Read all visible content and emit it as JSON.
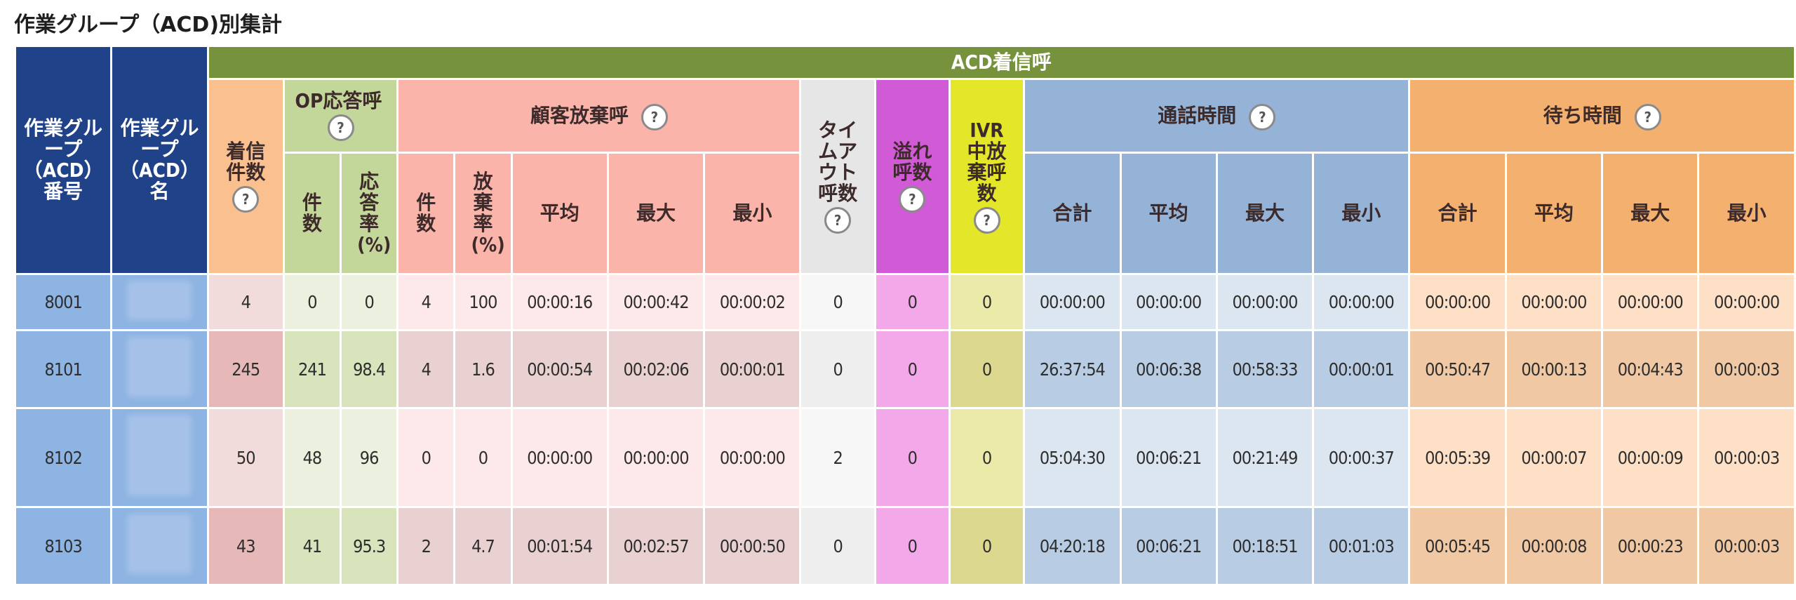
{
  "page_title": "作業グループ（ACD)別集計",
  "banner": "ACD着信呼",
  "help_glyph": "?",
  "headers": {
    "group_no": "作業グループ（ACD）番号",
    "group_name": "作業グループ（ACD）名",
    "incoming": "着信件数",
    "op_answer": "OP応答呼",
    "op_count": "件数",
    "op_rate": "応答率(%)",
    "abandon": "顧客放棄呼",
    "ab_count": "件数",
    "ab_rate": "放棄率(%)",
    "ab_avg": "平均",
    "ab_max": "最大",
    "ab_min": "最小",
    "timeout": "タイムアウト呼数",
    "overflow": "溢れ呼数",
    "ivr": "IVR中放棄呼数",
    "talk": "通話時間",
    "tk_total": "合計",
    "tk_avg": "平均",
    "tk_max": "最大",
    "tk_min": "最小",
    "wait": "待ち時間",
    "wt_total": "合計",
    "wt_avg": "平均",
    "wt_max": "最大",
    "wt_min": "最小"
  },
  "rows": [
    {
      "id": "8001",
      "incoming": "4",
      "op_count": "0",
      "op_rate": "0",
      "ab_count": "4",
      "ab_rate": "100",
      "ab_avg": "00:00:16",
      "ab_max": "00:00:42",
      "ab_min": "00:00:02",
      "timeout": "0",
      "overflow": "0",
      "ivr": "0",
      "tk_total": "00:00:00",
      "tk_avg": "00:00:00",
      "tk_max": "00:00:00",
      "tk_min": "00:00:00",
      "wt_total": "00:00:00",
      "wt_avg": "00:00:00",
      "wt_max": "00:00:00",
      "wt_min": "00:00:00"
    },
    {
      "id": "8101",
      "incoming": "245",
      "op_count": "241",
      "op_rate": "98.4",
      "ab_count": "4",
      "ab_rate": "1.6",
      "ab_avg": "00:00:54",
      "ab_max": "00:02:06",
      "ab_min": "00:00:01",
      "timeout": "0",
      "overflow": "0",
      "ivr": "0",
      "tk_total": "26:37:54",
      "tk_avg": "00:06:38",
      "tk_max": "00:58:33",
      "tk_min": "00:00:01",
      "wt_total": "00:50:47",
      "wt_avg": "00:00:13",
      "wt_max": "00:04:43",
      "wt_min": "00:00:03"
    },
    {
      "id": "8102",
      "incoming": "50",
      "op_count": "48",
      "op_rate": "96",
      "ab_count": "0",
      "ab_rate": "0",
      "ab_avg": "00:00:00",
      "ab_max": "00:00:00",
      "ab_min": "00:00:00",
      "timeout": "2",
      "overflow": "0",
      "ivr": "0",
      "tk_total": "05:04:30",
      "tk_avg": "00:06:21",
      "tk_max": "00:21:49",
      "tk_min": "00:00:37",
      "wt_total": "00:05:39",
      "wt_avg": "00:00:07",
      "wt_max": "00:00:09",
      "wt_min": "00:00:03"
    },
    {
      "id": "8103",
      "incoming": "43",
      "op_count": "41",
      "op_rate": "95.3",
      "ab_count": "2",
      "ab_rate": "4.7",
      "ab_avg": "00:01:54",
      "ab_max": "00:02:57",
      "ab_min": "00:00:50",
      "timeout": "0",
      "overflow": "0",
      "ivr": "0",
      "tk_total": "04:20:18",
      "tk_avg": "00:06:21",
      "tk_max": "00:18:51",
      "tk_min": "00:01:03",
      "wt_total": "00:05:45",
      "wt_avg": "00:00:08",
      "wt_max": "00:00:23",
      "wt_min": "00:00:03"
    }
  ]
}
